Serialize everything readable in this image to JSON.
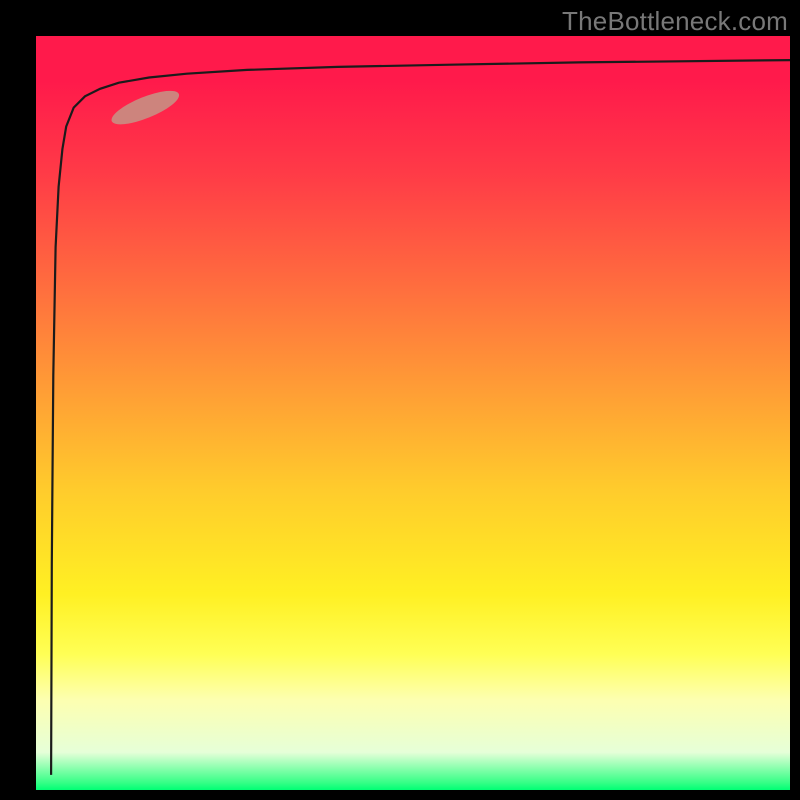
{
  "attribution": "TheBottleneck.com",
  "colors": {
    "bg": "#000000",
    "attribution": "#787878",
    "curve": "#1b1b1b",
    "marker": "#cd847d"
  },
  "chart_data": {
    "type": "line",
    "title": "",
    "xlabel": "",
    "ylabel": "",
    "xlim": [
      0,
      100
    ],
    "ylim": [
      0,
      100
    ],
    "grid": false,
    "notes": "Background is a vertical gradient from red (top) through orange/yellow to green (bottom). A single dark curve starts near the bottom-left, rises almost vertically, then asymptotes near the top. A small rounded salmon-colored marker highlights a segment on the rising shoulder of the curve.",
    "series": [
      {
        "name": "curve",
        "x": [
          2.0,
          2.1,
          2.3,
          2.6,
          3.0,
          3.5,
          4.0,
          5.0,
          6.5,
          8.5,
          11,
          15,
          20,
          28,
          40,
          55,
          72,
          100
        ],
        "y": [
          2,
          30,
          55,
          72,
          80,
          85,
          88,
          90.5,
          92,
          93,
          93.8,
          94.5,
          95,
          95.5,
          95.9,
          96.2,
          96.5,
          96.8
        ]
      }
    ],
    "marker": {
      "cx": 14.5,
      "cy": 90.5,
      "rx": 4.8,
      "ry": 1.4,
      "angle_deg": -22
    }
  }
}
